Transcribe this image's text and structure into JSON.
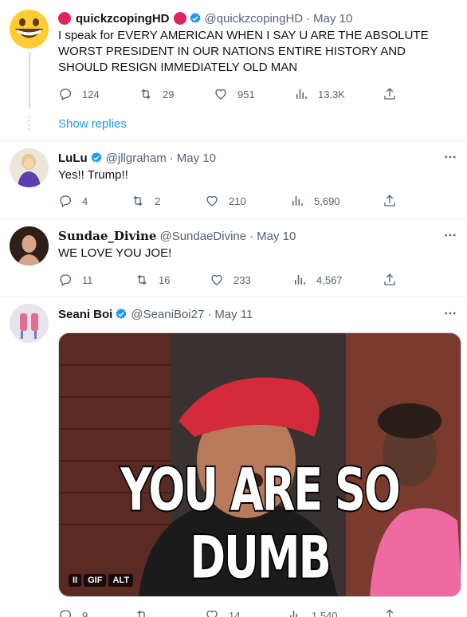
{
  "tweets": [
    {
      "name": "quickzcopingHD",
      "handle": "@quickzcopingHD",
      "date": "May 10",
      "text": "I speak for EVERY AMERICAN WHEN I SAY U ARE THE ABSOLUTE WORST PRESIDENT IN OUR NATIONS ENTIRE HISTORY AND SHOULD RESIGN IMMEDIATELY OLD MAN",
      "replies": "124",
      "retweets": "29",
      "likes": "951",
      "views": "13.3K",
      "avatar_icon": "grinning-emoji"
    },
    {
      "name": "LuLu",
      "handle": "@jllgraham",
      "date": "May 10",
      "text": "Yes!! Trump!!",
      "replies": "4",
      "retweets": "2",
      "likes": "210",
      "views": "5,690"
    },
    {
      "name": "Sundae_Divine",
      "handle": "@SundaeDivine",
      "date": "May 10",
      "text": "WE LOVE YOU JOE!",
      "replies": "11",
      "retweets": "16",
      "likes": "233",
      "views": "4,567"
    },
    {
      "name": "Seani Boi",
      "handle": "@SeaniBoi27",
      "date": "May 11",
      "media_caption": "YOU ARE SO DUMB",
      "media_pills": [
        "II",
        "GIF",
        "ALT"
      ],
      "replies": "9",
      "retweets": "",
      "likes": "14",
      "views": "1,540"
    }
  ],
  "show_replies": "Show replies",
  "separator": "·",
  "colors": {
    "verified": "#1d9bf0",
    "link": "#1d9bf0",
    "muted": "#536471",
    "text": "#0f1419",
    "red_badge": "#e0245e"
  }
}
